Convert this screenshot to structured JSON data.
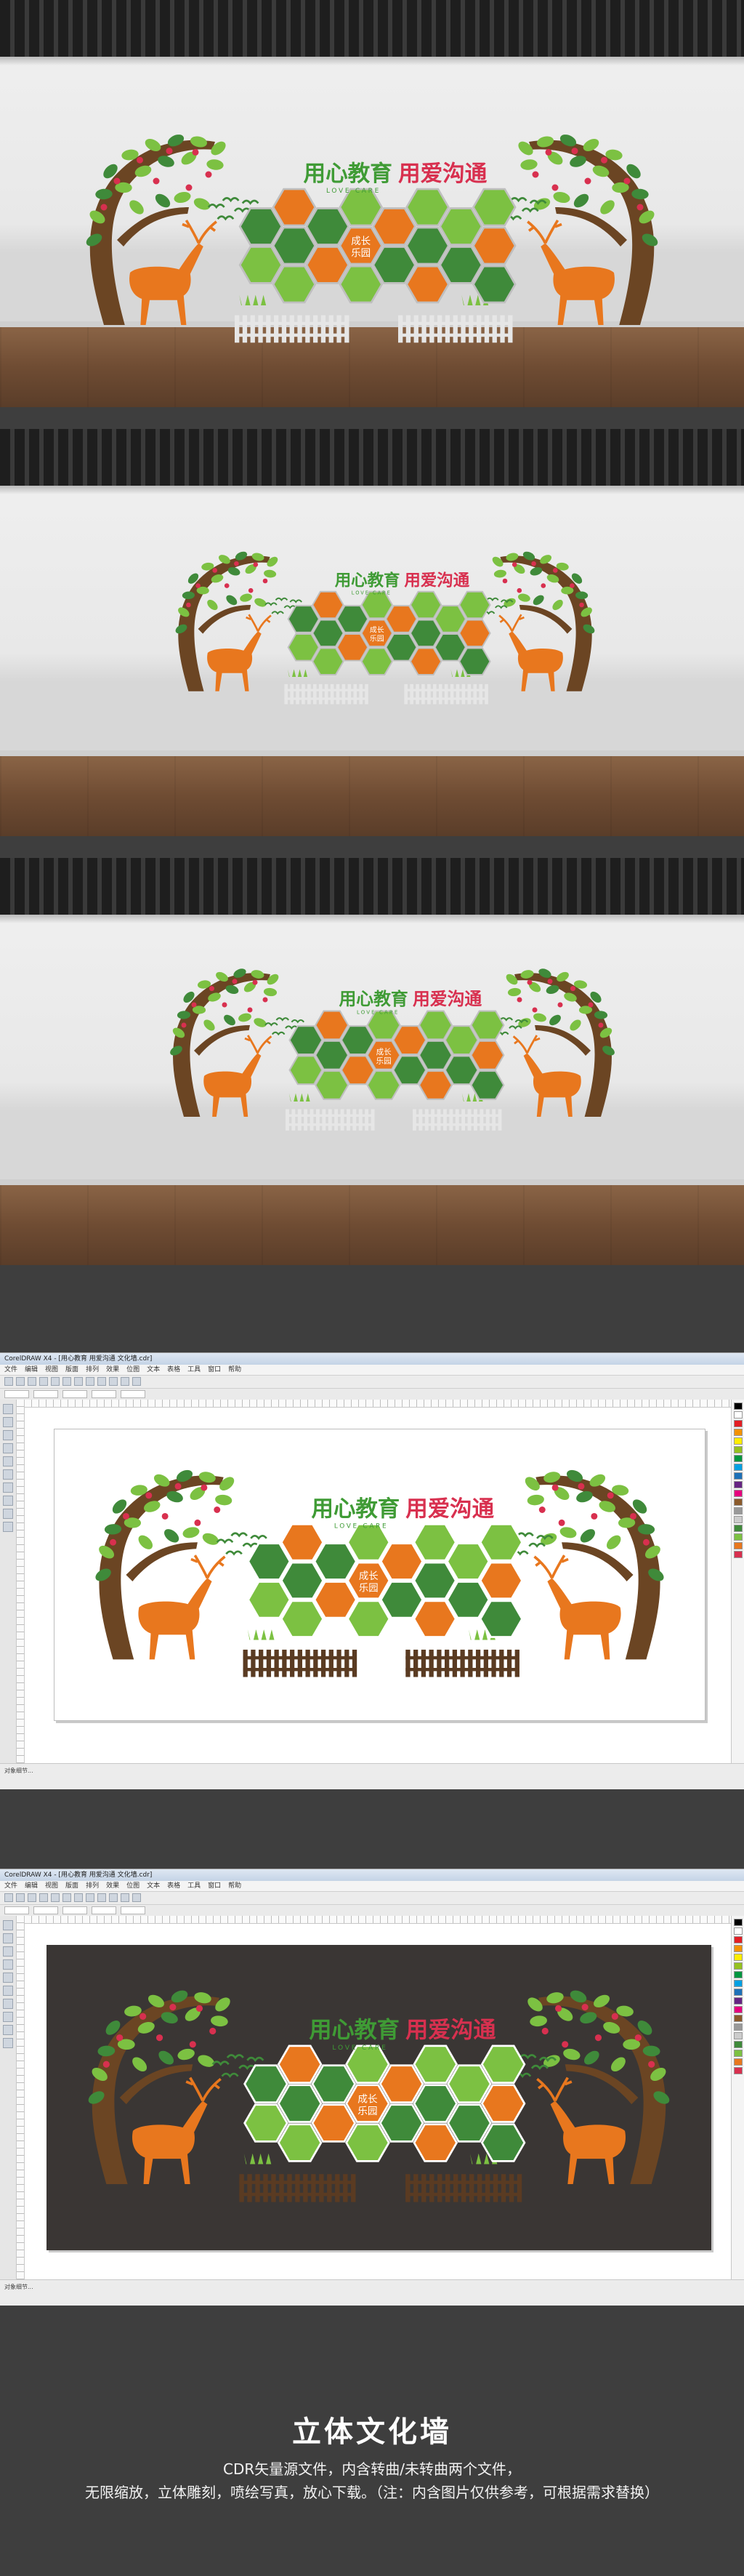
{
  "wall": {
    "main_slogan_left": "用心教育",
    "main_slogan_right": "用爱沟通",
    "english_subtitle": "LOVE CARE",
    "center_badge_line1": "成长",
    "center_badge_line2": "乐园"
  },
  "software": {
    "window_title": "CorelDRAW X4 - [用心教育 用爱沟通 文化墙.cdr]",
    "menu_items": [
      "文件",
      "编辑",
      "视图",
      "版面",
      "排列",
      "效果",
      "位图",
      "文本",
      "表格",
      "工具",
      "窗口",
      "帮助"
    ],
    "status_text": "对象细节..."
  },
  "footer": {
    "title": "立体文化墙",
    "line1": "CDR矢量源文件，内含转曲/未转曲两个文件，",
    "line2": "无限缩放，立体雕刻，喷绘写真，放心下载。（注：内含图片仅供参考，可根据需求替换）"
  },
  "colors": {
    "page_background": "#3e3e3e",
    "green_dark": "#3f8a3a",
    "green_light": "#7cc142",
    "orange": "#e8771e",
    "brown_tree": "#6b4523",
    "slogan_green": "#3f9b35",
    "slogan_red": "#d8304f",
    "canvas_dark_bg": "#3a3634"
  }
}
